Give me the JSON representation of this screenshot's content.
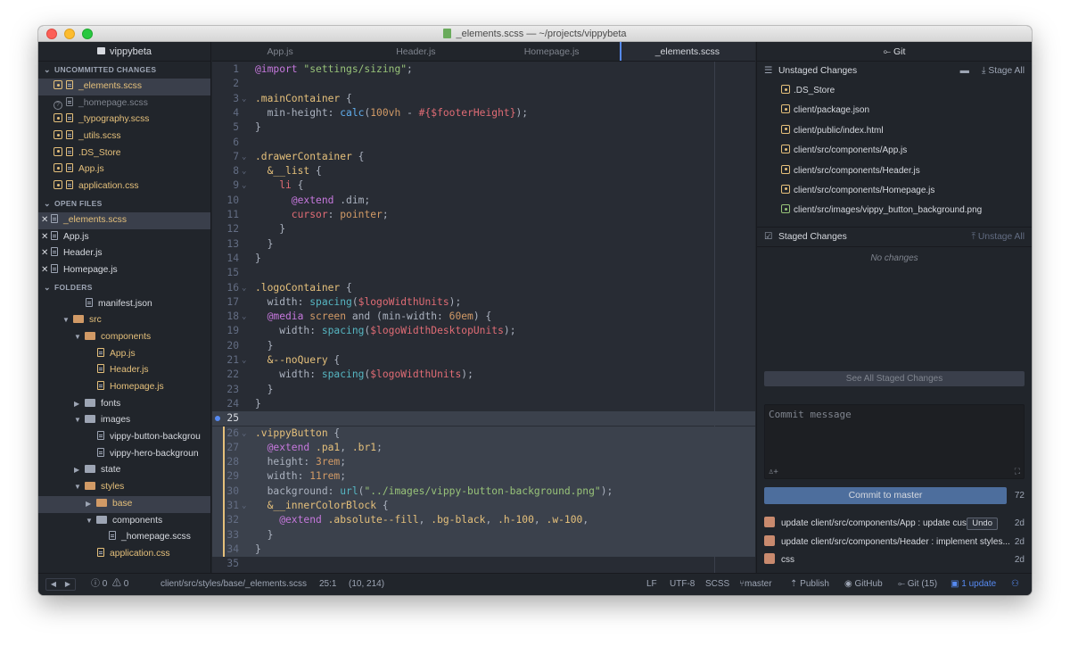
{
  "title": "_elements.scss — ~/projects/vippybeta",
  "project": "vippybeta",
  "sections": {
    "uncommitted": "UNCOMMITTED CHANGES",
    "open": "OPEN FILES",
    "folders": "FOLDERS"
  },
  "uncommitted": [
    {
      "name": "_elements.scss",
      "state": "mod",
      "sel": true
    },
    {
      "name": "_homepage.scss",
      "state": "untr"
    },
    {
      "name": "_typography.scss",
      "state": "mod"
    },
    {
      "name": "_utils.scss",
      "state": "mod"
    },
    {
      "name": ".DS_Store",
      "state": "mod"
    },
    {
      "name": "App.js",
      "state": "mod"
    },
    {
      "name": "application.css",
      "state": "mod"
    }
  ],
  "open_files": [
    "_elements.scss",
    "App.js",
    "Header.js",
    "Homepage.js"
  ],
  "folders": [
    {
      "name": "manifest.json",
      "type": "file",
      "indent": 3
    },
    {
      "name": "src",
      "type": "folder",
      "open": true,
      "indent": 1,
      "color": "mod"
    },
    {
      "name": "components",
      "type": "folder",
      "open": true,
      "indent": 2,
      "color": "mod"
    },
    {
      "name": "App.js",
      "type": "file",
      "indent": 4,
      "color": "mod"
    },
    {
      "name": "Header.js",
      "type": "file",
      "indent": 4,
      "color": "mod"
    },
    {
      "name": "Homepage.js",
      "type": "file",
      "indent": 4,
      "color": "mod"
    },
    {
      "name": "fonts",
      "type": "folder",
      "open": false,
      "indent": 2
    },
    {
      "name": "images",
      "type": "folder",
      "open": true,
      "indent": 2
    },
    {
      "name": "vippy-button-backgrou",
      "type": "file",
      "indent": 4
    },
    {
      "name": "vippy-hero-backgroun",
      "type": "file",
      "indent": 4
    },
    {
      "name": "state",
      "type": "folder",
      "open": false,
      "indent": 2
    },
    {
      "name": "styles",
      "type": "folder",
      "open": true,
      "indent": 2,
      "color": "mod"
    },
    {
      "name": "base",
      "type": "folder",
      "open": false,
      "indent": 3,
      "color": "mod",
      "sel": true
    },
    {
      "name": "components",
      "type": "folder",
      "open": true,
      "indent": 3
    },
    {
      "name": "_homepage.scss",
      "type": "file",
      "indent": 5
    },
    {
      "name": "application.css",
      "type": "file",
      "indent": 4,
      "color": "mod"
    }
  ],
  "tabs": [
    "App.js",
    "Header.js",
    "Homepage.js",
    "_elements.scss"
  ],
  "code": [
    [
      [
        "k",
        "@import "
      ],
      [
        "s",
        "\"settings/sizing\""
      ],
      [
        "p",
        ";"
      ]
    ],
    [],
    [
      [
        "sel",
        ".mainContainer"
      ],
      [
        "p",
        " {"
      ]
    ],
    [
      [
        "p",
        "  min-height: "
      ],
      [
        "f",
        "calc"
      ],
      [
        "p",
        "("
      ],
      [
        "c",
        "100vh"
      ],
      [
        "p",
        " - "
      ],
      [
        "v",
        "#{$footerHeight}"
      ],
      [
        "p",
        ");"
      ]
    ],
    [
      [
        "p",
        "}"
      ]
    ],
    [],
    [
      [
        "sel",
        ".drawerContainer"
      ],
      [
        "p",
        " {"
      ]
    ],
    [
      [
        "sel",
        "  &__list"
      ],
      [
        "p",
        " {"
      ]
    ],
    [
      [
        "v",
        "    li"
      ],
      [
        "p",
        " {"
      ]
    ],
    [
      [
        "k",
        "      @extend"
      ],
      [
        "p",
        " .dim;"
      ]
    ],
    [
      [
        "v",
        "      cursor"
      ],
      [
        "p",
        ": "
      ],
      [
        "c",
        "pointer"
      ],
      [
        "p",
        ";"
      ]
    ],
    [
      [
        "p",
        "    }"
      ]
    ],
    [
      [
        "p",
        "  }"
      ]
    ],
    [
      [
        "p",
        "}"
      ]
    ],
    [],
    [
      [
        "sel",
        ".logoContainer"
      ],
      [
        "p",
        " {"
      ]
    ],
    [
      [
        "p",
        "  width: "
      ],
      [
        "u",
        "spacing"
      ],
      [
        "p",
        "("
      ],
      [
        "v",
        "$logoWidthUnits"
      ],
      [
        "p",
        ");"
      ]
    ],
    [
      [
        "k",
        "  @media"
      ],
      [
        "c",
        " screen"
      ],
      [
        "p",
        " and (min-width: "
      ],
      [
        "c",
        "60em"
      ],
      [
        "p",
        ") {"
      ]
    ],
    [
      [
        "p",
        "    width: "
      ],
      [
        "u",
        "spacing"
      ],
      [
        "p",
        "("
      ],
      [
        "v",
        "$logoWidthDesktopUnits"
      ],
      [
        "p",
        ");"
      ]
    ],
    [
      [
        "p",
        "  }"
      ]
    ],
    [
      [
        "sel",
        "  &--noQuery"
      ],
      [
        "p",
        " {"
      ]
    ],
    [
      [
        "p",
        "    width: "
      ],
      [
        "u",
        "spacing"
      ],
      [
        "p",
        "("
      ],
      [
        "v",
        "$logoWidthUnits"
      ],
      [
        "p",
        ");"
      ]
    ],
    [
      [
        "p",
        "  }"
      ]
    ],
    [
      [
        "p",
        "}"
      ]
    ],
    [],
    [
      [
        "sel",
        ".vippyButton"
      ],
      [
        "p",
        " {"
      ]
    ],
    [
      [
        "k",
        "  @extend"
      ],
      [
        "sel",
        " .pa1"
      ],
      [
        "p",
        ", "
      ],
      [
        "sel",
        ".br1"
      ],
      [
        "p",
        ";"
      ]
    ],
    [
      [
        "p",
        "  height: "
      ],
      [
        "c",
        "3rem"
      ],
      [
        "p",
        ";"
      ]
    ],
    [
      [
        "p",
        "  width: "
      ],
      [
        "c",
        "11rem"
      ],
      [
        "p",
        ";"
      ]
    ],
    [
      [
        "p",
        "  background: "
      ],
      [
        "u",
        "url"
      ],
      [
        "p",
        "("
      ],
      [
        "s",
        "\"../images/vippy-button-background.png\""
      ],
      [
        "p",
        ");"
      ]
    ],
    [
      [
        "sel",
        "  &__innerColorBlock"
      ],
      [
        "p",
        " {"
      ]
    ],
    [
      [
        "k",
        "    @extend"
      ],
      [
        "sel",
        " .absolute--fill"
      ],
      [
        "p",
        ", "
      ],
      [
        "sel",
        ".bg-black"
      ],
      [
        "p",
        ", "
      ],
      [
        "sel",
        ".h-100"
      ],
      [
        "p",
        ", "
      ],
      [
        "sel",
        ".w-100"
      ],
      [
        "p",
        ","
      ]
    ],
    [
      [
        "p",
        "  }"
      ]
    ],
    [
      [
        "p",
        "}"
      ]
    ],
    []
  ],
  "git": {
    "tab": "Git",
    "unstaged_title": "Unstaged Changes",
    "stage_all": "Stage All",
    "unstaged": [
      ".DS_Store",
      "client/package.json",
      "client/public/index.html",
      "client/src/components/App.js",
      "client/src/components/Header.js",
      "client/src/components/Homepage.js",
      "client/src/images/vippy_button_background.png"
    ],
    "staged_title": "Staged Changes",
    "unstage_all": "Unstage All",
    "no_changes": "No changes",
    "see_all": "See All Staged Changes",
    "commit_placeholder": "Commit message",
    "commit_btn": "Commit to master",
    "count": "72",
    "recent": [
      {
        "msg": "update client/src/components/App : update cust...",
        "time": "2d",
        "undo": "Undo"
      },
      {
        "msg": "update client/src/components/Header : implement styles...",
        "time": "2d"
      },
      {
        "msg": "css",
        "time": "2d"
      }
    ]
  },
  "status": {
    "errors": "0",
    "warnings": "0",
    "path": "client/src/styles/base/_elements.scss",
    "cursor": "25:1",
    "sel": "(10, 214)",
    "eol": "LF",
    "enc": "UTF-8",
    "grammar": "SCSS",
    "branch": "master",
    "publish": "Publish",
    "github": "GitHub",
    "git": "Git (15)",
    "update": "1 update"
  }
}
